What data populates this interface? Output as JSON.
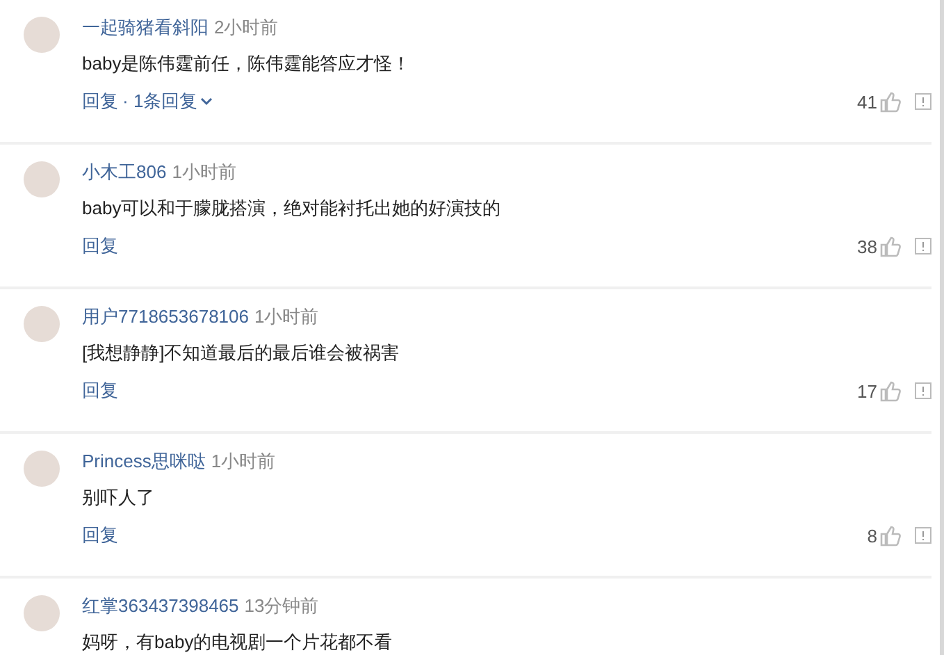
{
  "comments": [
    {
      "user": "一起骑猪看斜阳",
      "time": "2小时前",
      "text": "baby是陈伟霆前任，陈伟霆能答应才怪！",
      "reply": "回复",
      "replies": "· 1条回复",
      "likes": "41"
    },
    {
      "user": "小木工806",
      "time": "1小时前",
      "text": "baby可以和于朦胧搭演，绝对能衬托出她的好演技的",
      "reply": "回复",
      "likes": "38"
    },
    {
      "user": "用户7718653678106",
      "time": "1小时前",
      "text": "[我想静静]不知道最后的最后谁会被祸害",
      "reply": "回复",
      "likes": "17"
    },
    {
      "user": "Princess思咪哒",
      "time": "1小时前",
      "text": "别吓人了",
      "reply": "回复",
      "likes": "8"
    },
    {
      "user": "红掌363437398465",
      "time": "13分钟前",
      "text": "妈呀，有baby的电视剧一个片花都不看"
    }
  ]
}
